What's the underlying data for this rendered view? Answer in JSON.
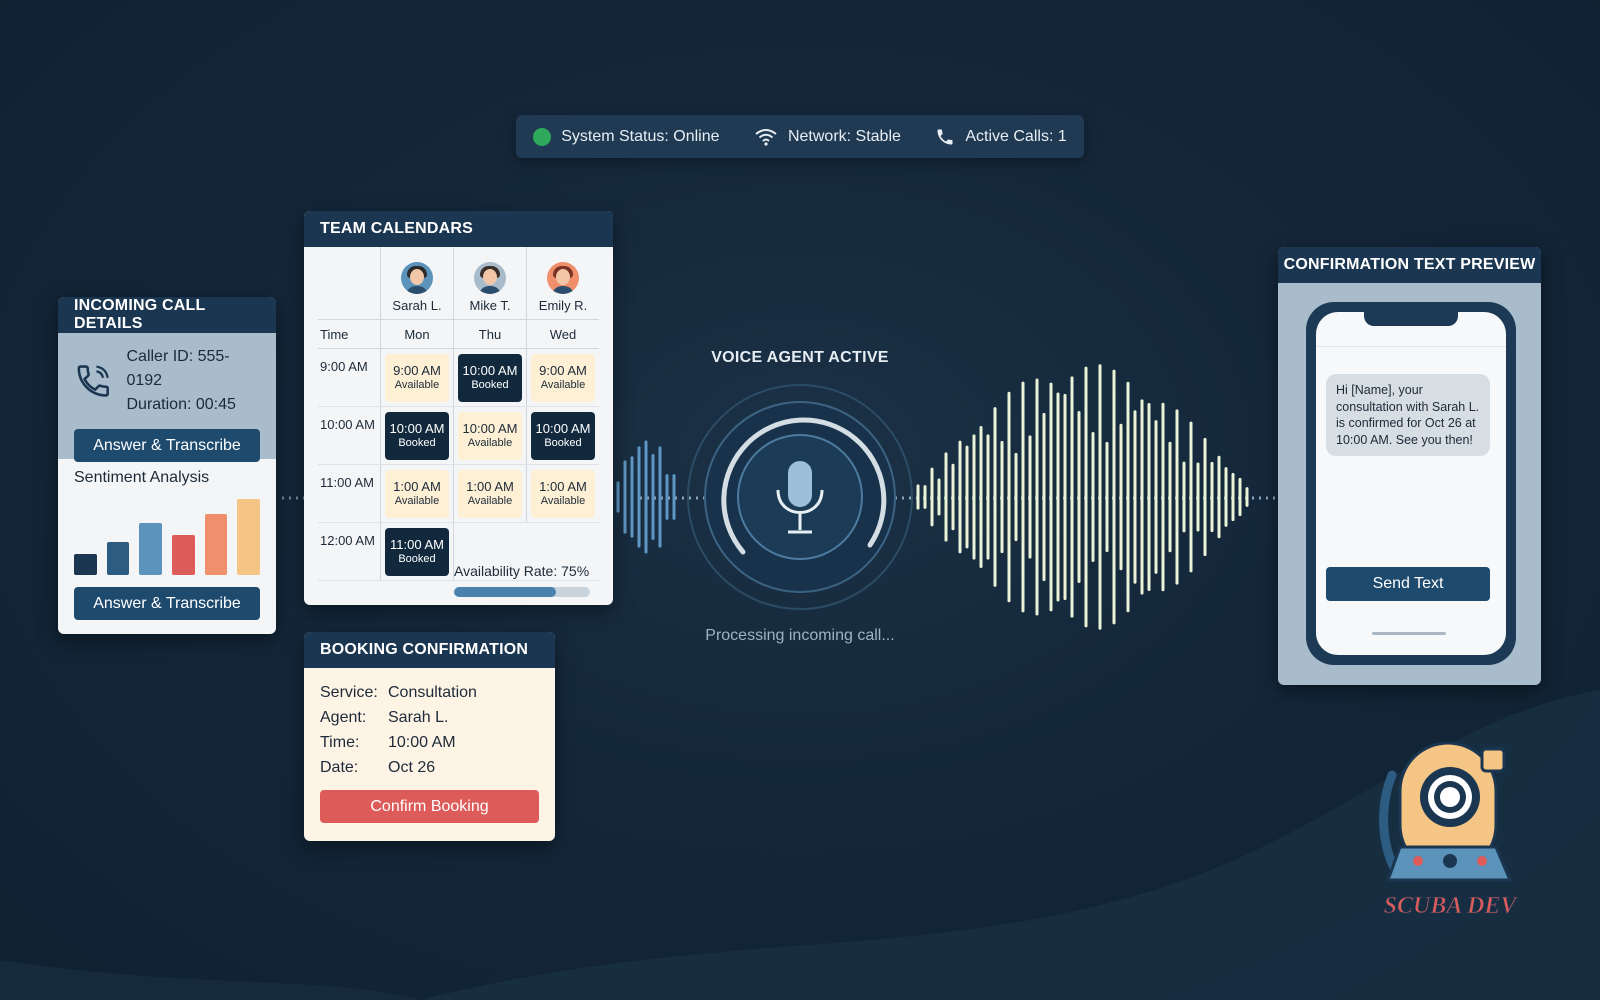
{
  "status_bar": {
    "system_status": "System Status: Online",
    "network": "Network: Stable",
    "active_calls": "Active Calls: 1",
    "status_color": "#2ea85a"
  },
  "incoming_call": {
    "title": "INCOMING CALL DETAILS",
    "caller_id": "Caller ID: 555-0192",
    "duration": "Duration: 00:45",
    "answer_button_top": "Answer & Transcribe",
    "sentiment_title": "Sentiment Analysis",
    "sentiment_bars": [
      {
        "level": 0.28,
        "color": "#1b3650"
      },
      {
        "level": 0.44,
        "color": "#2d5c82"
      },
      {
        "level": 0.68,
        "color": "#5b93bb"
      },
      {
        "level": 0.52,
        "color": "#dd5b58"
      },
      {
        "level": 0.8,
        "color": "#ef8f6b"
      },
      {
        "level": 1.0,
        "color": "#f4c584"
      }
    ],
    "answer_button_bottom": "Answer & Transcribe"
  },
  "calendars": {
    "title": "TEAM CALENDARS",
    "time_header": "Time",
    "agents": [
      {
        "name": "Sarah L.",
        "day": "Mon",
        "avatar_bg": "#5b93bb",
        "hair": "#2f2a2a",
        "avatar_icon": "person-avatar-icon"
      },
      {
        "name": "Mike T.",
        "day": "Thu",
        "avatar_bg": "#a8bccc",
        "hair": "#3b2f2a",
        "avatar_icon": "person-avatar-icon"
      },
      {
        "name": "Emily R.",
        "day": "Wed",
        "avatar_bg": "#ef8f6b",
        "hair": "#7a3324",
        "avatar_icon": "person-avatar-icon"
      }
    ],
    "rows": [
      {
        "time": "9:00 AM",
        "slots": [
          {
            "time": "9:00 AM",
            "state": "Available",
            "booked": false
          },
          {
            "time": "10:00 AM",
            "state": "Booked",
            "booked": true
          },
          {
            "time": "9:00 AM",
            "state": "Available",
            "booked": false
          }
        ]
      },
      {
        "time": "10:00 AM",
        "slots": [
          {
            "time": "10:00 AM",
            "state": "Booked",
            "booked": true
          },
          {
            "time": "10:00 AM",
            "state": "Available",
            "booked": false
          },
          {
            "time": "10:00 AM",
            "state": "Booked",
            "booked": true
          }
        ]
      },
      {
        "time": "11:00 AM",
        "slots": [
          {
            "time": "1:00 AM",
            "state": "Available",
            "booked": false
          },
          {
            "time": "1:00 AM",
            "state": "Available",
            "booked": false
          },
          {
            "time": "1:00 AM",
            "state": "Available",
            "booked": false
          }
        ]
      },
      {
        "time": "12:00 AM",
        "slots": [
          {
            "time": "11:00 AM",
            "state": "Booked",
            "booked": true
          }
        ]
      }
    ],
    "availability_label": "Availability Rate: 75%",
    "availability_rate": 0.75
  },
  "booking": {
    "title": "BOOKING CONFIRMATION",
    "fields": [
      {
        "label": "Service:",
        "value": "Consultation"
      },
      {
        "label": "Agent:",
        "value": "Sarah L."
      },
      {
        "label": "Time:",
        "value": "10:00 AM"
      },
      {
        "label": "Date:",
        "value": "Oct 26"
      }
    ],
    "confirm_button": "Confirm Booking"
  },
  "voice_agent": {
    "title": "VOICE AGENT ACTIVE",
    "status": "Processing incoming call...",
    "icon": "microphone-icon"
  },
  "preview": {
    "title": "CONFIRMATION TEXT PREVIEW",
    "message": "Hi [Name], your consultation with Sarah L. is confirmed for Oct 26 at 10:00 AM. See you then!",
    "send_button": "Send Text"
  },
  "logo": {
    "text": "SCUBA DEV",
    "icon": "diving-helmet-icon"
  }
}
